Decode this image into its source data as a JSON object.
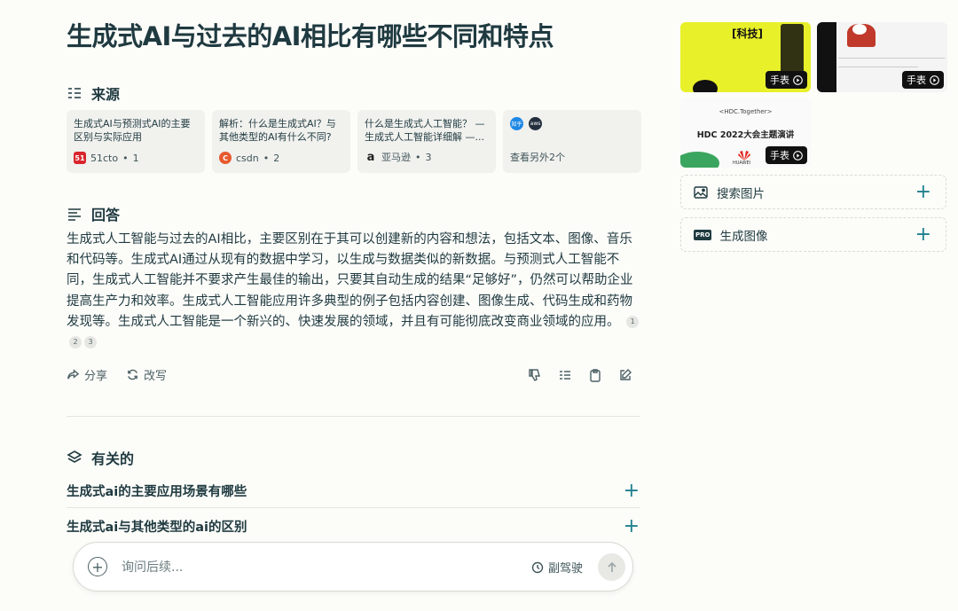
{
  "title": "生成式AI与过去的AI相比有哪些不同和特点",
  "sources_section": {
    "heading": "来源",
    "items": [
      {
        "title": "生成式AI与预测式AI的主要区别与实际应用",
        "site": "51cto",
        "index": "1",
        "logo_text": "51",
        "logo_color": "#d9262c"
      },
      {
        "title": "解析：什么是生成式AI？与其他类型的AI有什么不同?",
        "site": "csdn",
        "index": "2",
        "logo_text": "C",
        "logo_color": "#e65a2d"
      },
      {
        "title": "什么是生成式人工智能？ — 生成式人工智能详细解 —...",
        "site": "亚马逊",
        "index": "3",
        "logo_text": "a",
        "logo_color": "#222222"
      }
    ],
    "more": {
      "label": "查看另外2个",
      "logos": [
        "知乎",
        "aws"
      ]
    }
  },
  "answer_section": {
    "heading": "回答",
    "text": "生成式人工智能与过去的AI相比，主要区别在于其可以创建新的内容和想法，包括文本、图像、音乐和代码等。生成式AI通过从现有的数据中学习，以生成与数据类似的新数据。与预测式人工智能不同，生成式人工智能并不要求产生最佳的输出，只要其自动生成的结果“足够好”，仍然可以帮助企业提高生产力和效率。生成式人工智能应用许多典型的例子包括内容创建、图像生成、代码生成和药物发现等。生成式人工智能是一个新兴的、快速发展的领域，并且有可能彻底改变商业领域的应用。",
    "citations": [
      "1",
      "2",
      "3"
    ]
  },
  "actions": {
    "share": "分享",
    "rewrite": "改写"
  },
  "related_section": {
    "heading": "有关的",
    "items": [
      "生成式ai的主要应用场景有哪些",
      "生成式ai与其他类型的ai的区别"
    ]
  },
  "input": {
    "placeholder": "询问后续...",
    "value": "",
    "copilot_label": "副驾驶"
  },
  "sidebar": {
    "videos": [
      {
        "badge": "手表",
        "overlay_text": "[科技]"
      },
      {
        "badge": "手表"
      },
      {
        "badge": "手表",
        "overlay_text": "HDC 2022大会主题演讲",
        "brand_text": "<HDC.Together>",
        "sponsor_text": "HUAWEI"
      }
    ],
    "search_images": "搜索图片",
    "generate_image": "生成图像",
    "pro_badge": "PRO"
  },
  "colors": {
    "accent": "#20808d",
    "background": "#fcfcf9",
    "text": "#1f3a40"
  }
}
